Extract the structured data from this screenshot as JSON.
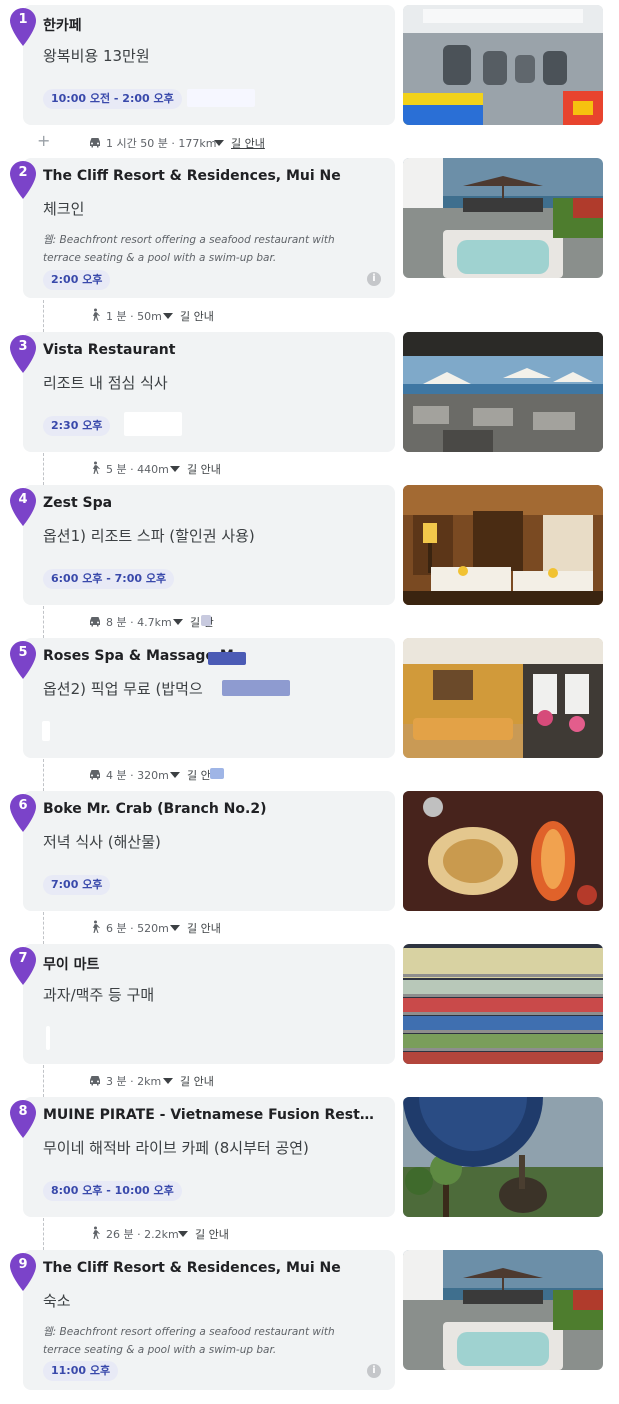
{
  "colors": {
    "pin": "#7b43c9",
    "badge_bg": "#e8eaf6",
    "badge_text": "#3949ab",
    "card_bg": "#f1f3f4"
  },
  "stops": [
    {
      "num": "1",
      "title": "한카페",
      "desc": "왕복비용 13만원",
      "time": "10:00 오전 - 2:00 오후",
      "image": "bus-interior"
    },
    {
      "num": "2",
      "title": "The Cliff Resort & Residences, Mui Ne",
      "desc": "체크인",
      "note_prefix": "웹:",
      "note": "Beachfront resort offering a seafood restaurant with terrace seating & a pool with a swim-up bar.",
      "time": "2:00 오후",
      "image": "resort-terrace-jacuzzi"
    },
    {
      "num": "3",
      "title": "Vista Restaurant",
      "desc": "리조트 내 점심 식사",
      "time": "2:30 오후",
      "image": "restaurant-terrace"
    },
    {
      "num": "4",
      "title": "Zest Spa",
      "desc": "옵션1) 리조트 스파 (할인권 사용)",
      "time": "6:00 오후 - 7:00 오후",
      "image": "spa-room"
    },
    {
      "num": "5",
      "title": "Roses Spa & Massage M",
      "desc": "옵션2) 픽업 무료 (밥먹으",
      "time": "",
      "image": "massage-lounge"
    },
    {
      "num": "6",
      "title": "Boke Mr. Crab (Branch No.2)",
      "desc": "저녁 식사 (해산물)",
      "time": "7:00 오후",
      "image": "grilled-seafood"
    },
    {
      "num": "7",
      "title": "무이 마트",
      "desc": "과자/맥주 등 구매",
      "time": "",
      "image": "mart-fridge"
    },
    {
      "num": "8",
      "title": "MUINE PIRATE - Vietnamese Fusion Restauran...",
      "desc": "무이네 해적바 라이브 카페 (8시부터 공연)",
      "time": "8:00 오후 - 10:00 오후",
      "image": "pirate-sign"
    },
    {
      "num": "9",
      "title": "The Cliff Resort & Residences, Mui Ne",
      "desc": "숙소",
      "note_prefix": "웹:",
      "note": "Beachfront resort offering a seafood restaurant with terrace seating & a pool with a swim-up bar.",
      "time": "11:00 오후",
      "image": "resort-terrace-jacuzzi"
    }
  ],
  "legs": [
    {
      "mode": "car-icon",
      "text": "1 시간 50 분 · 177km",
      "directions": "길 안내"
    },
    {
      "mode": "walk-icon",
      "text": "1 분 · 50m",
      "directions": "길 안내"
    },
    {
      "mode": "walk-icon",
      "text": "5 분 · 440m",
      "directions": "길 안내"
    },
    {
      "mode": "car-icon",
      "text": "8 분 · 4.7km",
      "directions": "길 안"
    },
    {
      "mode": "car-icon",
      "text": "4 분 · 320m",
      "directions": "길 안"
    },
    {
      "mode": "walk-icon",
      "text": "6 분 · 520m",
      "directions": "길 안내"
    },
    {
      "mode": "car-icon",
      "text": "3 분 · 2km",
      "directions": "길 안내"
    },
    {
      "mode": "walk-icon",
      "text": "26 분 · 2.2km",
      "directions": "길 안내"
    }
  ]
}
